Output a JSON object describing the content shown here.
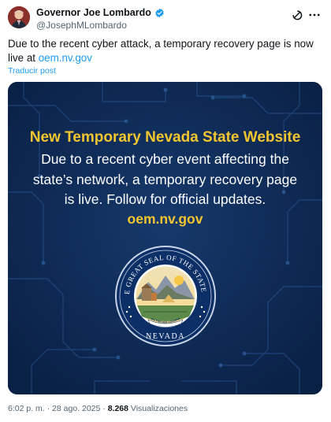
{
  "author": {
    "name": "Governor Joe Lombardo",
    "handle": "@JosephMLombardo"
  },
  "tweet": {
    "text": "Due to the recent cyber attack, a temporary recovery page is now live at",
    "link": "oem.nv.gov",
    "translate_label": "Traducir post"
  },
  "media": {
    "title": "New Temporary Nevada State Website",
    "body": "Due to a recent cyber event affecting the state’s network, a temporary recovery page is live. Follow for official updates.",
    "url": "oem.nv.gov",
    "seal": {
      "top_text": "THE GREAT SEAL OF THE STATE OF",
      "bottom_text": "NEVADA",
      "motto": "ALL FOR OUR COUNTRY"
    }
  },
  "meta": {
    "time": "6:02 p. m.",
    "separator": "·",
    "date": "28 ago. 2025",
    "views_count": "8.268",
    "views_label": "Visualizaciones"
  },
  "colors": {
    "media_bg": "#0e2a52",
    "accent_yellow": "#f3c62f",
    "link_blue": "#1d9bf0",
    "verified_blue": "#1d9bf0",
    "muted": "#536471"
  },
  "icons": {
    "verified": "verified-badge-icon",
    "grok": "grok-icon",
    "more": "more-options-icon"
  }
}
